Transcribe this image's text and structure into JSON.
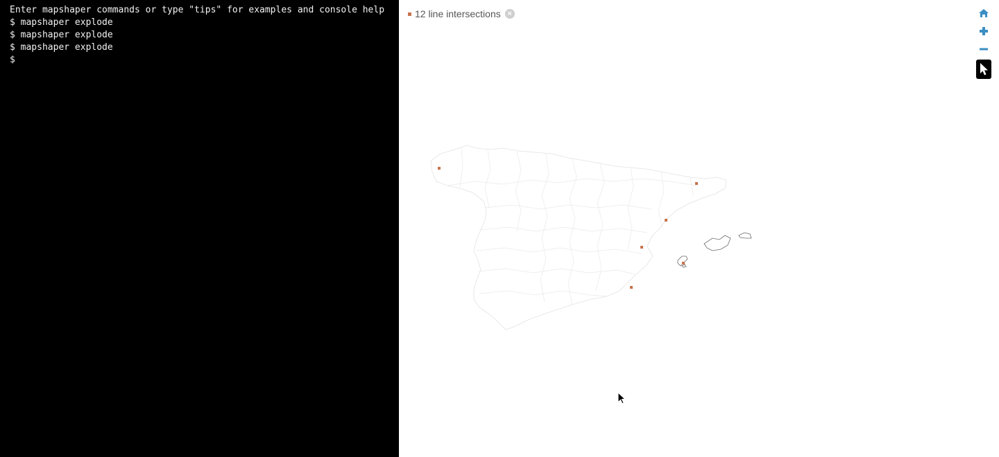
{
  "console": {
    "intro": "Enter mapshaper commands or type \"tips\" for examples and console help",
    "history": [
      "$ mapshaper explode",
      "$ mapshaper explode",
      "$ mapshaper explode"
    ],
    "prompt": "$ ",
    "input_value": ""
  },
  "map": {
    "intersections_label": "12 line intersections",
    "intersection_color": "#c8734c",
    "close_icon": "close-circle-icon",
    "tools": {
      "home_icon": "home-icon",
      "zoom_in_icon": "plus-icon",
      "zoom_out_icon": "minus-icon",
      "select_icon": "pointer-icon"
    },
    "tool_color": "#3a8ec4"
  }
}
